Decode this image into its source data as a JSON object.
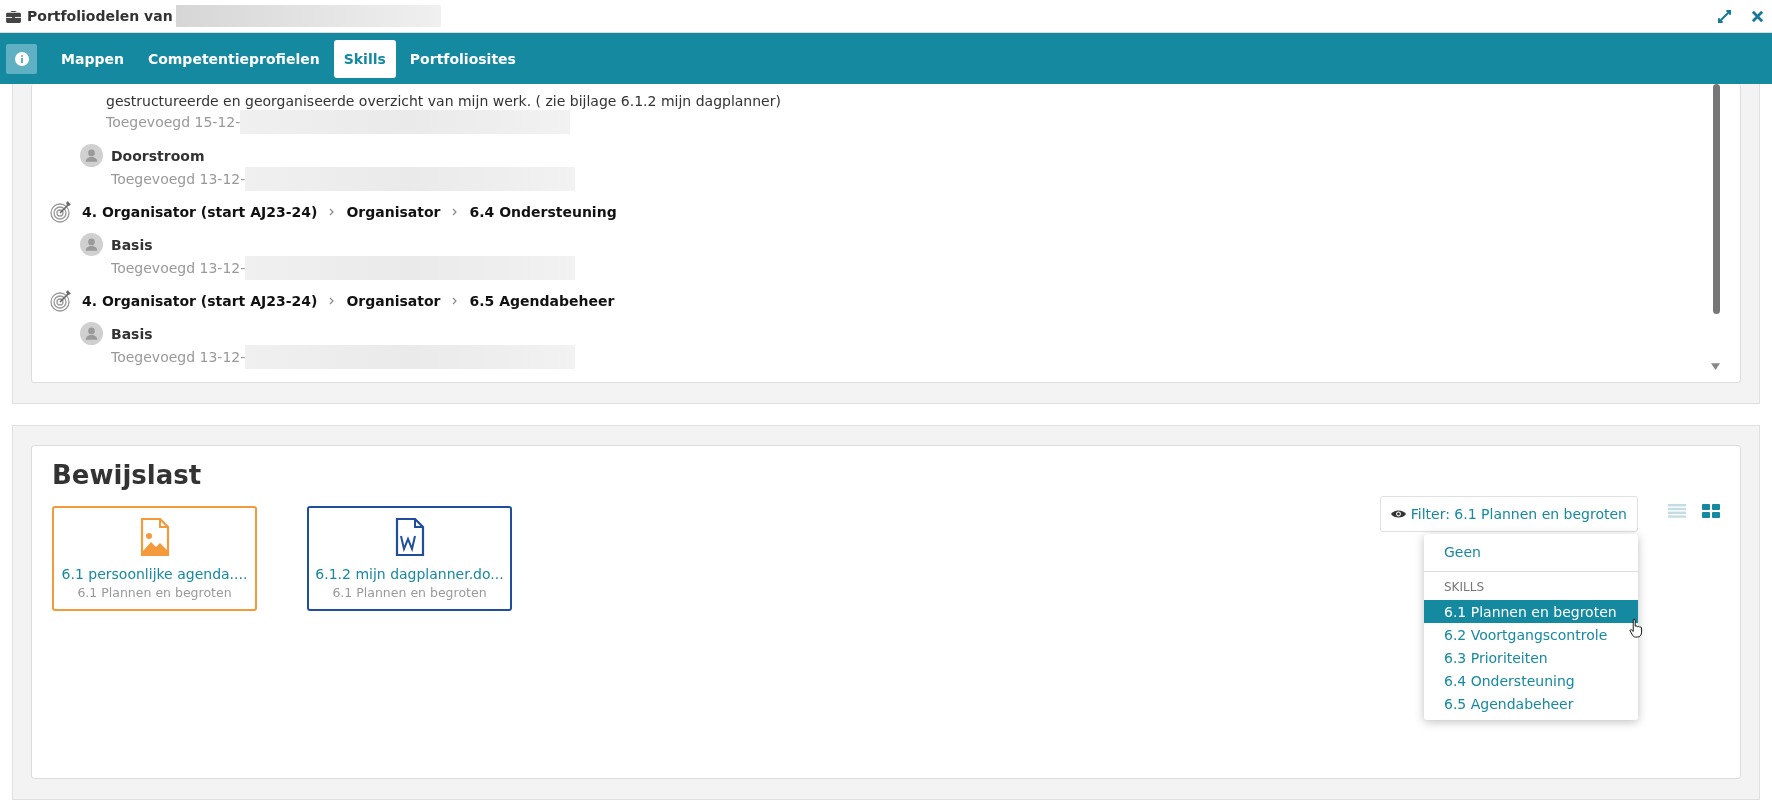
{
  "window": {
    "title": "Portfoliodelen van"
  },
  "tabs": [
    {
      "label": "Mappen",
      "selected": false
    },
    {
      "label": "Competentieprofielen",
      "selected": false
    },
    {
      "label": "Skills",
      "selected": true
    },
    {
      "label": "Portfoliosites",
      "selected": false
    }
  ],
  "entries": [
    {
      "kind": "comment",
      "text": "gestructureerde en georganiseerde overzicht van mijn werk. ( zie bijlage 6.1.2 mijn dagplanner)",
      "added": "Toegevoegd 15-12-"
    },
    {
      "kind": "level",
      "label": "Doorstroom",
      "added": "Toegevoegd 13-12-"
    },
    {
      "kind": "skill",
      "path": [
        "4. Organisator (start AJ23-24)",
        "Organisator",
        "6.4 Ondersteuning"
      ]
    },
    {
      "kind": "level",
      "label": "Basis",
      "added": "Toegevoegd 13-12-"
    },
    {
      "kind": "skill",
      "path": [
        "4. Organisator (start AJ23-24)",
        "Organisator",
        "6.5 Agendabeheer"
      ]
    },
    {
      "kind": "level",
      "label": "Basis",
      "added": "Toegevoegd 13-12-"
    }
  ],
  "evidence": {
    "title": "Bewijslast",
    "files": [
      {
        "kind": "image",
        "name": "6.1 persoonlijke agenda....",
        "skill": "6.1 Plannen en begroten",
        "color": "#f39a3c"
      },
      {
        "kind": "word",
        "name": "6.1.2 mijn dagplanner.do...",
        "skill": "6.1 Plannen en begroten",
        "color": "#1f4e9c"
      }
    ],
    "filter": {
      "label": "Filter: 6.1 Plannen en begroten",
      "expanded": true,
      "none": "Geen",
      "header": "SKILLS",
      "options": [
        {
          "label": "6.1 Plannen en begroten",
          "selected": true
        },
        {
          "label": "6.2 Voortgangscontrole",
          "selected": false
        },
        {
          "label": "6.3 Prioriteiten",
          "selected": false
        },
        {
          "label": "6.4 Ondersteuning",
          "selected": false
        },
        {
          "label": "6.5 Agendabeheer",
          "selected": false
        }
      ]
    },
    "views": [
      {
        "kind": "list",
        "selected": false
      },
      {
        "kind": "grid",
        "selected": true
      }
    ]
  }
}
